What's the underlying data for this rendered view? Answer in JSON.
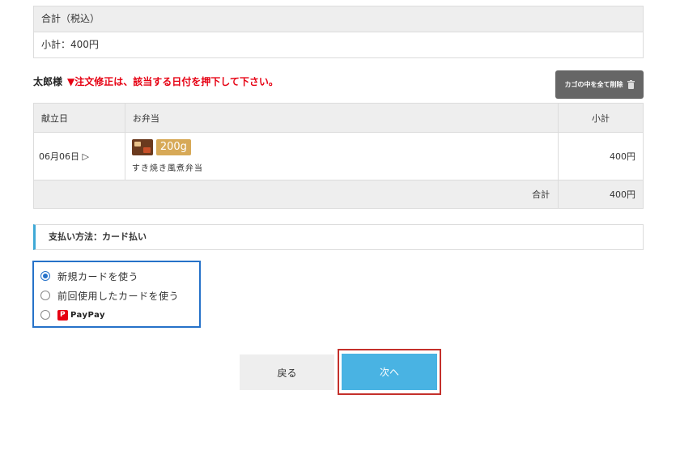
{
  "summary": {
    "header": "合計（税込）",
    "subtotal": "小計：400円"
  },
  "greeting": {
    "name": "太郎様",
    "notice": "▼注文修正は、該当する日付を押下して下さい。"
  },
  "clear_cart": {
    "label": "カゴの中を全て削除",
    "icon": "trash-icon"
  },
  "cart": {
    "columns": [
      "献立日",
      "お弁当",
      "小計"
    ],
    "rows": [
      {
        "date": "06月06日 ▷",
        "weight": "200g",
        "name": "すき焼き風煮弁当",
        "price": "400円"
      }
    ],
    "total_label": "合計",
    "total_value": "400円"
  },
  "payment": {
    "heading": "支払い方法：カード払い",
    "options": [
      {
        "label": "新規カードを使う",
        "selected": true
      },
      {
        "label": "前回使用したカードを使う",
        "selected": false
      },
      {
        "label": "PayPay",
        "selected": false
      }
    ]
  },
  "buttons": {
    "back": "戻る",
    "next": "次へ"
  },
  "colors": {
    "accent": "#49b3e3",
    "warning": "#e60012",
    "highlight_blue": "#2672c9",
    "highlight_red": "#c4302b"
  }
}
